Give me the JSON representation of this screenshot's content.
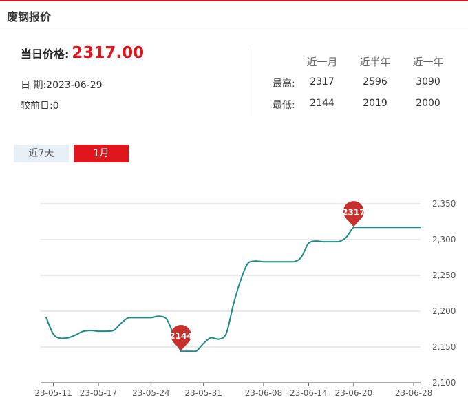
{
  "header": {
    "title": "废钢报价"
  },
  "summary": {
    "today_label": "当日价格:",
    "today_value": "2317.00",
    "date_text": "日  期:2023-06-29",
    "change_text": "较前日:0"
  },
  "stats": {
    "columns": [
      "近一月",
      "近半年",
      "近一年"
    ],
    "rows": [
      {
        "label": "最高:",
        "values": [
          "2317",
          "2596",
          "3090"
        ]
      },
      {
        "label": "最低:",
        "values": [
          "2144",
          "2019",
          "2000"
        ]
      }
    ]
  },
  "tabs": [
    {
      "label": "近7天",
      "active": false
    },
    {
      "label": "1月",
      "active": true
    }
  ],
  "colors": {
    "accent": "#e0161d",
    "line": "#1a8a8a",
    "pin": "#c7302c"
  },
  "chart_data": {
    "type": "line",
    "x_tick_labels": [
      "23-05-11",
      "23-05-17",
      "23-05-24",
      "23-05-31",
      "23-06-08",
      "23-06-14",
      "23-06-20",
      "23-06-28"
    ],
    "y_tick_labels": [
      "2,100",
      "2,150",
      "2,200",
      "2,250",
      "2,300",
      "2,350"
    ],
    "ylim": [
      2100,
      2350
    ],
    "grid": true,
    "series": [
      {
        "values": [
          [
            "2023-05-10",
            2192
          ],
          [
            "2023-05-11",
            2168
          ],
          [
            "2023-05-12",
            2162
          ],
          [
            "2023-05-13",
            2163
          ],
          [
            "2023-05-14",
            2167
          ],
          [
            "2023-05-15",
            2172
          ],
          [
            "2023-05-16",
            2173
          ],
          [
            "2023-05-17",
            2172
          ],
          [
            "2023-05-18",
            2172
          ],
          [
            "2023-05-19",
            2173
          ],
          [
            "2023-05-20",
            2183
          ],
          [
            "2023-05-21",
            2191
          ],
          [
            "2023-05-22",
            2191
          ],
          [
            "2023-05-23",
            2191
          ],
          [
            "2023-05-24",
            2191
          ],
          [
            "2023-05-25",
            2193
          ],
          [
            "2023-05-26",
            2190
          ],
          [
            "2023-05-27",
            2168
          ],
          [
            "2023-05-28",
            2144
          ],
          [
            "2023-05-29",
            2144
          ],
          [
            "2023-05-30",
            2144
          ],
          [
            "2023-05-31",
            2155
          ],
          [
            "2023-06-01",
            2163
          ],
          [
            "2023-06-02",
            2161
          ],
          [
            "2023-06-03",
            2168
          ],
          [
            "2023-06-04",
            2210
          ],
          [
            "2023-06-05",
            2245
          ],
          [
            "2023-06-06",
            2268
          ],
          [
            "2023-06-07",
            2270
          ],
          [
            "2023-06-08",
            2269
          ],
          [
            "2023-06-09",
            2269
          ],
          [
            "2023-06-10",
            2269
          ],
          [
            "2023-06-11",
            2269
          ],
          [
            "2023-06-12",
            2269
          ],
          [
            "2023-06-13",
            2275
          ],
          [
            "2023-06-14",
            2295
          ],
          [
            "2023-06-15",
            2298
          ],
          [
            "2023-06-16",
            2297
          ],
          [
            "2023-06-17",
            2297
          ],
          [
            "2023-06-18",
            2297
          ],
          [
            "2023-06-19",
            2303
          ],
          [
            "2023-06-20",
            2317
          ],
          [
            "2023-06-21",
            2317
          ],
          [
            "2023-06-22",
            2317
          ],
          [
            "2023-06-23",
            2317
          ],
          [
            "2023-06-24",
            2317
          ],
          [
            "2023-06-25",
            2317
          ],
          [
            "2023-06-26",
            2317
          ],
          [
            "2023-06-27",
            2317
          ],
          [
            "2023-06-28",
            2317
          ],
          [
            "2023-06-29",
            2317
          ]
        ]
      }
    ],
    "markers": [
      {
        "label": "2144",
        "x": "2023-05-28",
        "y": 2144
      },
      {
        "label": "2317",
        "x": "2023-06-20",
        "y": 2317
      }
    ]
  }
}
